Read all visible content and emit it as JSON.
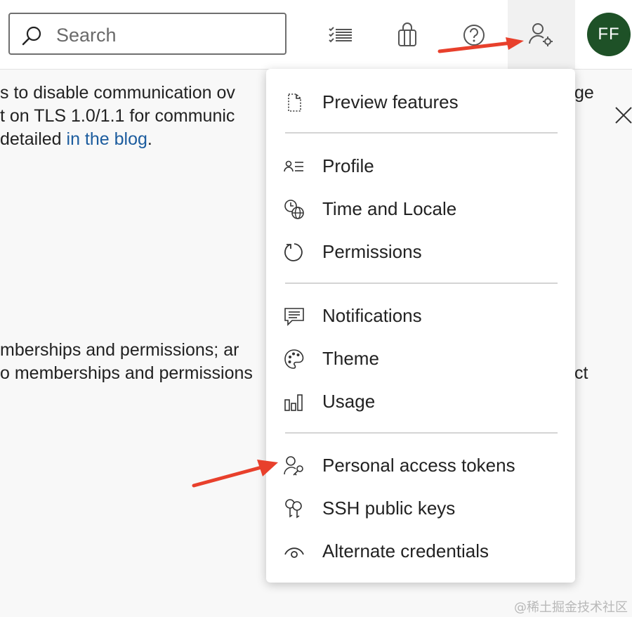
{
  "header": {
    "search": {
      "placeholder": "Search",
      "value": ""
    },
    "avatar_initials": "FF"
  },
  "background": {
    "lines_top": [
      "s to disable communication ov",
      "t on TLS 1.0/1.1 for communic",
      " detailed "
    ],
    "link_text": "in the blog",
    "link_suffix": ".",
    "right_fragment_1": "ge",
    "lines_bottom": [
      "mberships and permissions; ar",
      "o memberships and permissions"
    ],
    "right_fragment_2": "ct"
  },
  "menu": {
    "groups": [
      [
        {
          "label": "Preview features",
          "icon": "document-dotted-icon"
        }
      ],
      [
        {
          "label": "Profile",
          "icon": "contact-card-icon"
        },
        {
          "label": "Time and Locale",
          "icon": "clock-globe-icon"
        },
        {
          "label": "Permissions",
          "icon": "refresh-circle-icon"
        }
      ],
      [
        {
          "label": "Notifications",
          "icon": "chat-bubble-icon"
        },
        {
          "label": "Theme",
          "icon": "palette-icon"
        },
        {
          "label": "Usage",
          "icon": "bar-chart-icon"
        }
      ],
      [
        {
          "label": "Personal access tokens",
          "icon": "user-key-icon"
        },
        {
          "label": "SSH public keys",
          "icon": "keys-icon"
        },
        {
          "label": "Alternate credentials",
          "icon": "eye-icon"
        }
      ]
    ]
  },
  "watermark": "@稀土掘金技术社区",
  "colors": {
    "avatar_bg": "#1e5127",
    "link": "#1c5c9e",
    "arrow": "#e8402c"
  }
}
